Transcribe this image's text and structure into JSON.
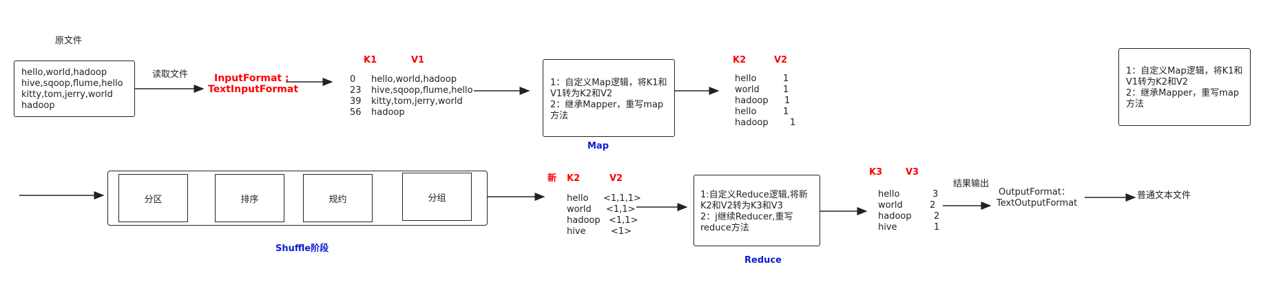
{
  "source": {
    "title": "原文件",
    "lines": [
      "hello,world,hadoop",
      "hive,sqoop,flume,hello",
      "kitty,tom,jerry,world",
      "hadoop"
    ]
  },
  "read_label": "读取文件",
  "input_format": {
    "line1": "InputFormat :",
    "line2": "TextInputFormat"
  },
  "kv1": {
    "k_header": "K1",
    "v_header": "V1",
    "rows": [
      {
        "k": "0",
        "v": "hello,world,hadoop"
      },
      {
        "k": "23",
        "v": "hive,sqoop,flume,hello"
      },
      {
        "k": "39",
        "v": "kitty,tom,jerry,world"
      },
      {
        "k": "56",
        "v": "hadoop"
      }
    ]
  },
  "map_box": {
    "lines": [
      "1：自定义Map逻辑，将K1和",
      "V1转为K2和V2",
      "2：继承Mapper，重写map",
      "方法"
    ],
    "label": "Map"
  },
  "kv2": {
    "k_header": "K2",
    "v_header": "V2",
    "rows": [
      {
        "k": "hello",
        "v": "1"
      },
      {
        "k": "world",
        "v": "1"
      },
      {
        "k": "hadoop",
        "v": "1"
      },
      {
        "k": "hello",
        "v": "1"
      },
      {
        "k": "hadoop",
        "v": "1"
      }
    ]
  },
  "note_box": {
    "lines": [
      "1：自定义Map逻辑，将K1和",
      "V1转为K2和V2",
      "2：继承Mapper，重写map",
      "方法"
    ]
  },
  "shuffle": {
    "steps": [
      "分区",
      "排序",
      "规约",
      "分组"
    ],
    "label": "Shuffle阶段"
  },
  "kv2_new": {
    "new_label": "新",
    "k_header": "K2",
    "v_header": "V2",
    "rows": [
      {
        "k": "hello",
        "v": "<1,1,1>"
      },
      {
        "k": "world",
        "v": "<1,1>"
      },
      {
        "k": "hadoop",
        "v": "<1,1>"
      },
      {
        "k": "hive",
        "v": "<1>"
      }
    ]
  },
  "reduce_box": {
    "lines": [
      "1:自定义Reduce逻辑,将新",
      "K2和V2转为K3和V3",
      "2：j继续Reducer,重写",
      "reduce方法"
    ],
    "label": "Reduce"
  },
  "kv3": {
    "k_header": "K3",
    "v_header": "V3",
    "rows": [
      {
        "k": "hello",
        "v": "3"
      },
      {
        "k": "world",
        "v": "2"
      },
      {
        "k": "hadoop",
        "v": "2"
      },
      {
        "k": "hive",
        "v": "1"
      }
    ]
  },
  "result_label": "结果输出",
  "output_format": {
    "line1": "OutputFormat：",
    "line2": "TextOutputFormat"
  },
  "final_label": "普通文本文件"
}
